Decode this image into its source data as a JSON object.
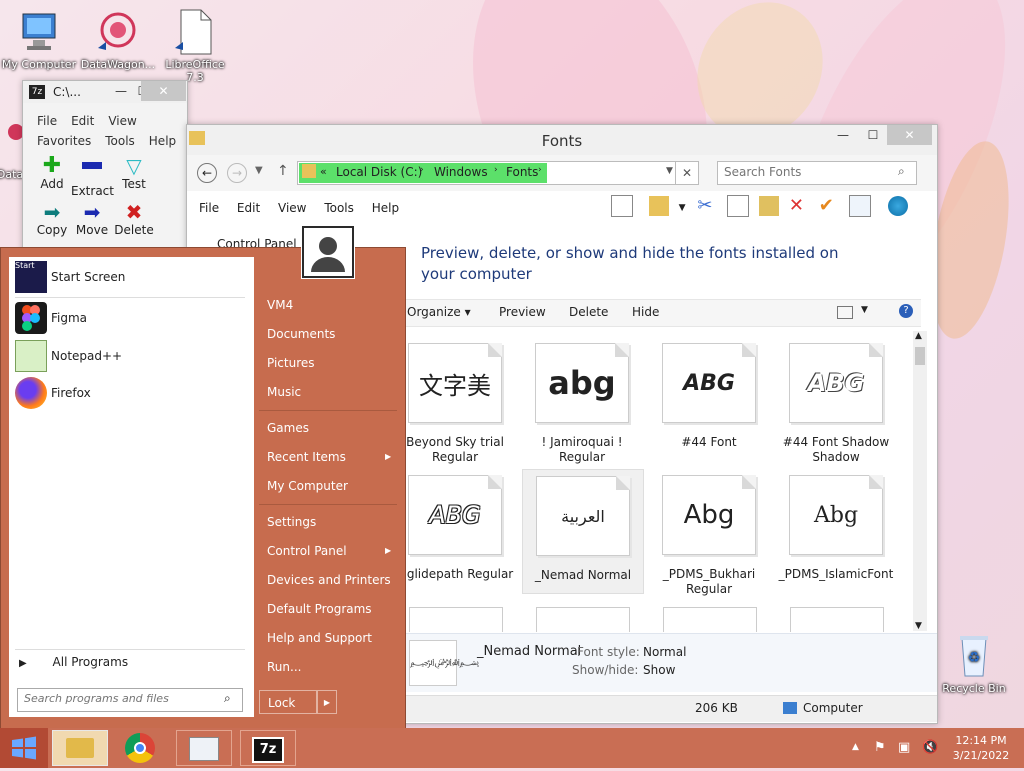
{
  "desktop_icons": [
    {
      "label": "My Computer"
    },
    {
      "label": "DataWagon..."
    },
    {
      "label": "LibreOffice 7.3"
    },
    {
      "label": "Data"
    },
    {
      "label": "Recycle Bin"
    }
  ],
  "zip_window": {
    "title": "C:\\...",
    "menu": [
      "File",
      "Edit",
      "View",
      "Favorites",
      "Tools",
      "Help"
    ],
    "tools": [
      "Add",
      "Extract",
      "Test",
      "Copy",
      "Move",
      "Delete"
    ]
  },
  "fonts_window": {
    "title": "Fonts",
    "address": [
      "Local Disk (C:)",
      "Windows",
      "Fonts"
    ],
    "search_placeholder": "Search Fonts",
    "menu": [
      "File",
      "Edit",
      "View",
      "Tools",
      "Help"
    ],
    "side_label": "Control Panel H",
    "heading": "Preview, delete, or show and hide the fonts installed on your computer",
    "cmdbar": [
      "Organize",
      "Preview",
      "Delete",
      "Hide"
    ],
    "fonts": [
      {
        "name": "Beyond Sky trial Regular",
        "sample": "文字美"
      },
      {
        "name": "! Jamiroquai ! Regular",
        "sample": "abg"
      },
      {
        "name": "#44 Font",
        "sample": "ABG"
      },
      {
        "name": "#44 Font Shadow Shadow",
        "sample": "ABG"
      },
      {
        "name": "#glidepath Regular",
        "sample": "ABG"
      },
      {
        "name": "_Nemad Normal",
        "sample": "ﺍﻟﻌﺮﺑﻴﺔ"
      },
      {
        "name": "_PDMS_Bukhari Regular",
        "sample": "Abg"
      },
      {
        "name": "_PDMS_IslamicFont",
        "sample": "Abg"
      }
    ],
    "details": {
      "name": "_Nemad Normal",
      "style_label": "Font style:",
      "style_value": "Normal",
      "show_label": "Show/hide:",
      "show_value": "Show"
    },
    "status": {
      "size": "206 KB",
      "location": "Computer"
    }
  },
  "start_menu": {
    "pinned": [
      "Start Screen",
      "Figma",
      "Notepad++",
      "Firefox"
    ],
    "all_programs": "All Programs",
    "search_placeholder": "Search programs and files",
    "right": [
      "VM4",
      "Documents",
      "Pictures",
      "Music",
      "Games",
      "Recent Items",
      "My Computer",
      "Settings",
      "Control Panel",
      "Devices and Printers",
      "Default Programs",
      "Help and Support",
      "Run..."
    ],
    "lock": "Lock"
  },
  "taskbar": {
    "time": "12:14 PM",
    "date": "3/21/2022"
  },
  "colors": {
    "accent": "#c76c4e",
    "selection": "#2c6aa8"
  }
}
